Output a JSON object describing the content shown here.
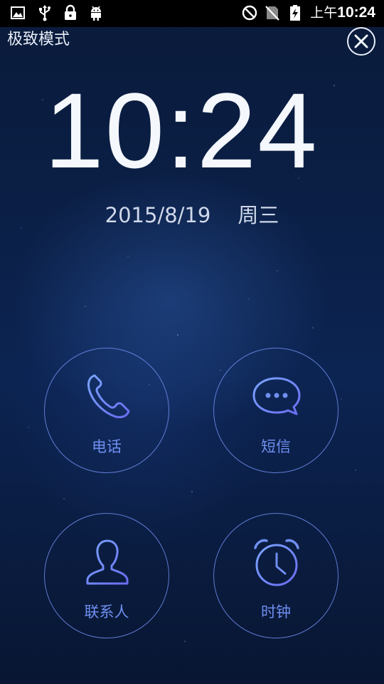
{
  "status_bar": {
    "icons": [
      "gallery-icon",
      "usb-icon",
      "lock-icon",
      "android-icon",
      "no-disturb-icon",
      "no-sim-icon",
      "battery-charging-icon"
    ],
    "ampm": "上午",
    "time": "10:24"
  },
  "header": {
    "title": "极致模式",
    "close_icon": "close-icon"
  },
  "clock": {
    "time": "10:24",
    "date": "2015/8/19",
    "weekday": "周三"
  },
  "apps": [
    {
      "label": "电话",
      "icon": "phone-icon"
    },
    {
      "label": "短信",
      "icon": "message-icon"
    },
    {
      "label": "联系人",
      "icon": "contact-icon"
    },
    {
      "label": "时钟",
      "icon": "alarm-clock-icon"
    }
  ],
  "colors": {
    "accent": "#6f8ff0",
    "background": "#0b2048",
    "text": "#f4f7fc"
  }
}
